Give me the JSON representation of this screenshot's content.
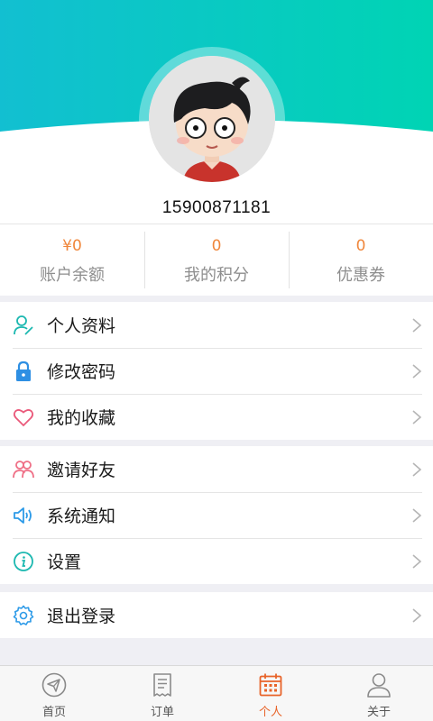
{
  "profile": {
    "phone": "15900871181"
  },
  "stats": [
    {
      "value": "¥0",
      "label": "账户余额"
    },
    {
      "value": "0",
      "label": "我的积分"
    },
    {
      "value": "0",
      "label": "优惠券"
    }
  ],
  "menu": {
    "group1": [
      {
        "label": "个人资料",
        "icon": "user-edit-icon"
      },
      {
        "label": "修改密码",
        "icon": "lock-icon"
      },
      {
        "label": "我的收藏",
        "icon": "heart-icon"
      }
    ],
    "group2": [
      {
        "label": "邀请好友",
        "icon": "users-icon"
      },
      {
        "label": "系统通知",
        "icon": "speaker-icon"
      },
      {
        "label": "设置",
        "icon": "info-icon"
      }
    ],
    "group3": [
      {
        "label": "退出登录",
        "icon": "gear-icon"
      }
    ]
  },
  "tabbar": {
    "items": [
      {
        "label": "首页",
        "icon": "paper-plane-icon"
      },
      {
        "label": "订单",
        "icon": "document-icon"
      },
      {
        "label": "个人",
        "icon": "calendar-icon"
      },
      {
        "label": "关于",
        "icon": "person-icon"
      }
    ],
    "active_index": 2
  },
  "colors": {
    "header_gradient_start": "#12bfd1",
    "header_gradient_end": "#00d4b4",
    "accent_orange": "#e8642a",
    "stat_value": "#f0873c"
  }
}
